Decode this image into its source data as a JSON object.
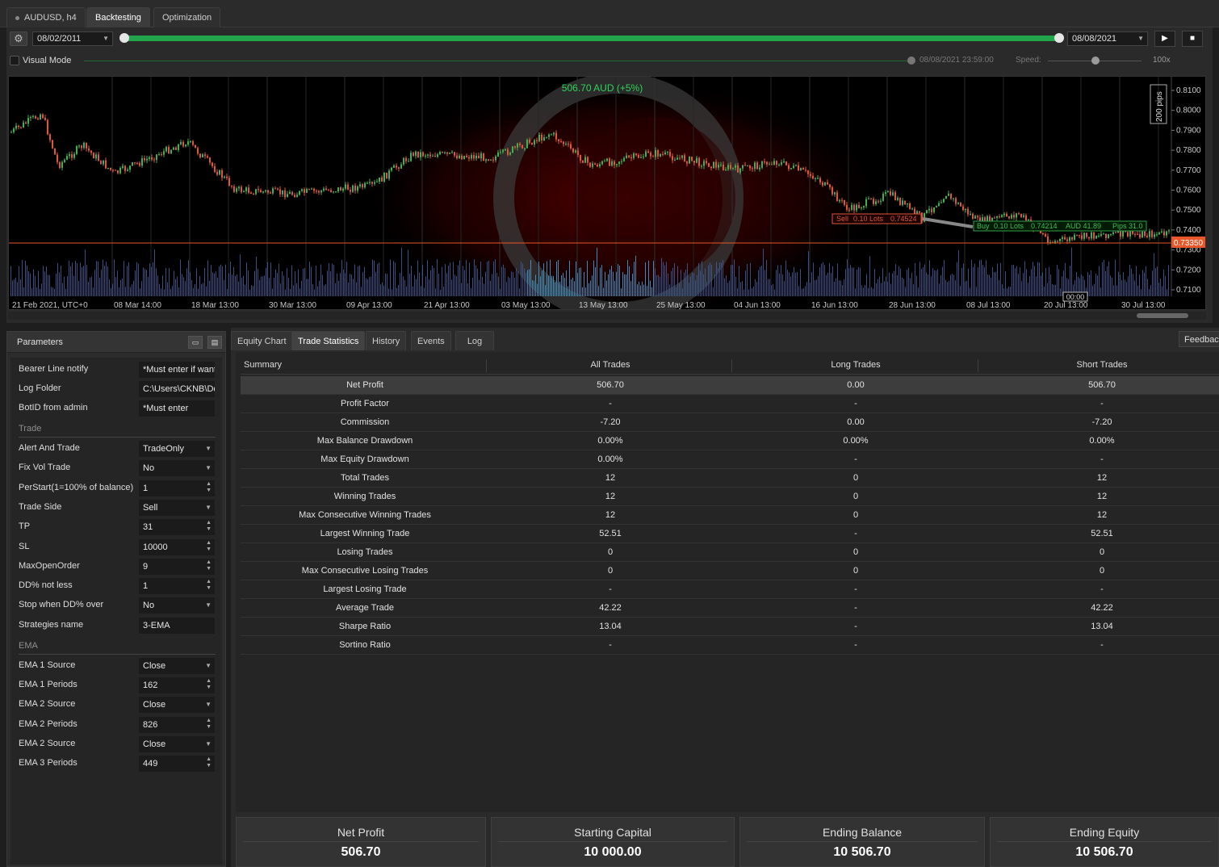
{
  "tabs": [
    {
      "label": "AUDUSD, h4"
    },
    {
      "label": "Backtesting"
    },
    {
      "label": "Optimization"
    }
  ],
  "controls": {
    "start_date": "08/02/2011",
    "end_date": "08/08/2021",
    "visual_mode_label": "Visual Mode",
    "visual_time": "08/08/2021 23:59:00",
    "speed_label": "Speed:",
    "speed_value": "100x"
  },
  "chart": {
    "profit_label": "506.70 AUD (+5%)",
    "price_ticks": [
      "0.8100",
      "0.8000",
      "0.7900",
      "0.7800",
      "0.7700",
      "0.7600",
      "0.7500",
      "0.7400",
      "0.7300",
      "0.7200",
      "0.7100"
    ],
    "current_price": "0.73350",
    "pips_label": "200 pips",
    "date_ticks": [
      "21 Feb 2021, UTC+0",
      "08 Mar 14:00",
      "18 Mar 13:00",
      "30 Mar 13:00",
      "09 Apr 13:00",
      "21 Apr 13:00",
      "03 May 13:00",
      "13 May 13:00",
      "25 May 13:00",
      "04 Jun 13:00",
      "16 Jun 13:00",
      "28 Jun 13:00",
      "08 Jul 13:00",
      "20 Jul 13:00",
      "30 Jul 13:00"
    ],
    "crosshair_time": "00:00",
    "sell_tag": {
      "side": "Sell",
      "lots": "0.10 Lots",
      "price": "0.74524"
    },
    "buy_tag": {
      "side": "Buy",
      "lots": "0.10 Lots",
      "price": "0.74214",
      "amount": "AUD 41.89",
      "pips": "Pips 31.0"
    }
  },
  "parameters": {
    "title": "Parameters",
    "rows": [
      {
        "label": "Bearer Line notify",
        "value": "*Must enter if want",
        "kind": "text"
      },
      {
        "label": "Log Folder",
        "value": "C:\\Users\\CKNB\\Doc",
        "kind": "text"
      },
      {
        "label": "BotID from admin",
        "value": "*Must enter",
        "kind": "text"
      }
    ],
    "trade_section": "Trade",
    "trade_rows": [
      {
        "label": "Alert And Trade",
        "value": "TradeOnly",
        "kind": "select"
      },
      {
        "label": "Fix Vol Trade",
        "value": "No",
        "kind": "select"
      },
      {
        "label": "PerStart(1=100% of balance)",
        "value": "1",
        "kind": "number"
      },
      {
        "label": "Trade Side",
        "value": "Sell",
        "kind": "select"
      },
      {
        "label": "TP",
        "value": "31",
        "kind": "number"
      },
      {
        "label": "SL",
        "value": "10000",
        "kind": "number"
      },
      {
        "label": "MaxOpenOrder",
        "value": "9",
        "kind": "number"
      },
      {
        "label": "DD% not less",
        "value": "1",
        "kind": "number"
      },
      {
        "label": "Stop when DD% over",
        "value": "No",
        "kind": "select"
      },
      {
        "label": "Strategies name",
        "value": "3-EMA",
        "kind": "text"
      }
    ],
    "ema_section": "EMA",
    "ema_rows": [
      {
        "label": "EMA 1 Source",
        "value": "Close",
        "kind": "select"
      },
      {
        "label": "EMA 1 Periods",
        "value": "162",
        "kind": "number"
      },
      {
        "label": "EMA 2 Source",
        "value": "Close",
        "kind": "select"
      },
      {
        "label": "EMA 2 Periods",
        "value": "826",
        "kind": "number"
      },
      {
        "label": "EMA 2 Source",
        "value": "Close",
        "kind": "select"
      },
      {
        "label": "EMA 3 Periods",
        "value": "449",
        "kind": "number"
      }
    ]
  },
  "bottom_tabs": [
    {
      "label": "Equity Chart"
    },
    {
      "label": "Trade Statistics"
    },
    {
      "label": "History"
    },
    {
      "label": "Events"
    },
    {
      "label": "Log"
    }
  ],
  "feedback_label": "Feedback",
  "stats": {
    "headers": [
      "Summary",
      "All Trades",
      "Long Trades",
      "Short Trades"
    ],
    "rows": [
      {
        "name": "Net Profit",
        "all": "506.70",
        "long": "0.00",
        "short": "506.70"
      },
      {
        "name": "Profit Factor",
        "all": "-",
        "long": "-",
        "short": "-"
      },
      {
        "name": "Commission",
        "all": "-7.20",
        "long": "0.00",
        "short": "-7.20"
      },
      {
        "name": "Max Balance Drawdown",
        "all": "0.00%",
        "long": "0.00%",
        "short": "0.00%"
      },
      {
        "name": "Max Equity Drawdown",
        "all": "0.00%",
        "long": "-",
        "short": "-"
      },
      {
        "name": "Total Trades",
        "all": "12",
        "long": "0",
        "short": "12"
      },
      {
        "name": "Winning Trades",
        "all": "12",
        "long": "0",
        "short": "12"
      },
      {
        "name": "Max Consecutive Winning Trades",
        "all": "12",
        "long": "0",
        "short": "12"
      },
      {
        "name": "Largest Winning Trade",
        "all": "52.51",
        "long": "-",
        "short": "52.51"
      },
      {
        "name": "Losing Trades",
        "all": "0",
        "long": "0",
        "short": "0"
      },
      {
        "name": "Max Consecutive Losing Trades",
        "all": "0",
        "long": "0",
        "short": "0"
      },
      {
        "name": "Largest Losing Trade",
        "all": "-",
        "long": "-",
        "short": "-"
      },
      {
        "name": "Average Trade",
        "all": "42.22",
        "long": "-",
        "short": "42.22"
      },
      {
        "name": "Sharpe Ratio",
        "all": "13.04",
        "long": "-",
        "short": "13.04"
      },
      {
        "name": "Sortino Ratio",
        "all": "-",
        "long": "-",
        "short": "-"
      }
    ]
  },
  "summary_cards": [
    {
      "title": "Net Profit",
      "value": "506.70"
    },
    {
      "title": "Starting Capital",
      "value": "10 000.00"
    },
    {
      "title": "Ending Balance",
      "value": "10 506.70"
    },
    {
      "title": "Ending Equity",
      "value": "10 506.70"
    }
  ],
  "colors": {
    "accent_green": "#22a54a",
    "price_line": "#e8562a",
    "bull": "#3fb24f",
    "bear": "#e0563a",
    "volume": "#3f5f9e"
  }
}
